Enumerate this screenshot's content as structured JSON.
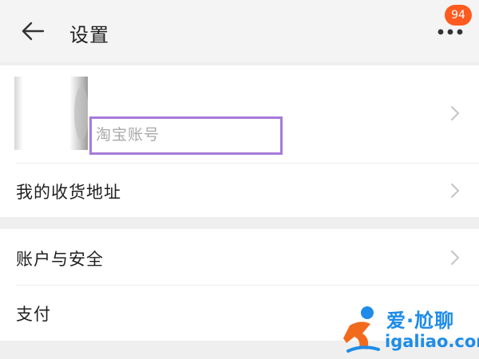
{
  "header": {
    "title": "设置",
    "back_icon": "arrow-left-icon",
    "more_icon": "more-dots-icon",
    "badge_count": "94"
  },
  "profile": {
    "account_label": "淘宝账号",
    "chevron_icon": "chevron-right-icon"
  },
  "menu": {
    "address": "我的收货地址",
    "security": "账户与安全",
    "payment": "支付"
  },
  "watermark": {
    "brand": "爱·尬聊",
    "url": "igaliao.com"
  },
  "colors": {
    "badge": "#ff5a1f",
    "highlight": "#a67bd9",
    "watermark": "#1e8ce8"
  }
}
